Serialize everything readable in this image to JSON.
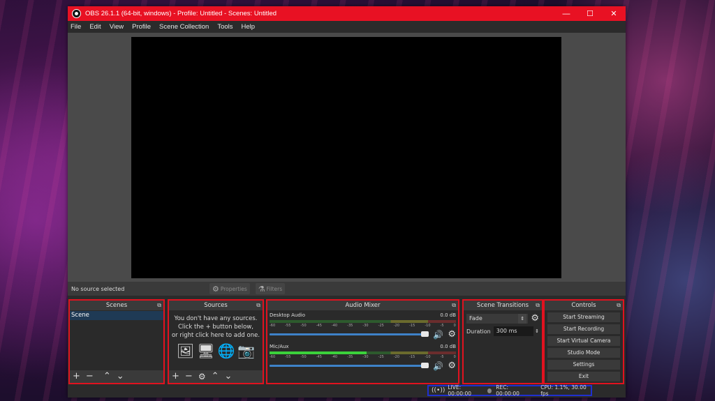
{
  "window": {
    "title": "OBS 26.1.1 (64-bit, windows) - Profile: Untitled - Scenes: Untitled"
  },
  "menu": [
    "File",
    "Edit",
    "View",
    "Profile",
    "Scene Collection",
    "Tools",
    "Help"
  ],
  "source_bar": {
    "no_source": "No source selected",
    "properties": "Properties",
    "filters": "Filters"
  },
  "scenes": {
    "title": "Scenes",
    "items": [
      "Scene"
    ]
  },
  "sources": {
    "title": "Sources",
    "empty_line1": "You don't have any sources.",
    "empty_line2": "Click the + button below,",
    "empty_line3": "or right click here to add one."
  },
  "mixer": {
    "title": "Audio Mixer",
    "tracks": [
      {
        "name": "Desktop Audio",
        "db": "0.0 dB",
        "level": 0.0
      },
      {
        "name": "Mic/Aux",
        "db": "0.0 dB",
        "level": 0.52
      }
    ],
    "ticks": [
      "-60",
      "-55",
      "-50",
      "-45",
      "-40",
      "-35",
      "-30",
      "-25",
      "-20",
      "-15",
      "-10",
      "-5",
      "0"
    ]
  },
  "transitions": {
    "title": "Scene Transitions",
    "selected": "Fade",
    "duration_label": "Duration",
    "duration_value": "300 ms"
  },
  "controls": {
    "title": "Controls",
    "buttons": [
      "Start Streaming",
      "Start Recording",
      "Start Virtual Camera",
      "Studio Mode",
      "Settings",
      "Exit"
    ]
  },
  "status": {
    "live": "LIVE: 00:00:00",
    "rec": "REC: 00:00:00",
    "cpu": "CPU: 1.1%, 30.00 fps"
  },
  "colors": {
    "title_bar": "#e81123",
    "panel_outline": "#e1121f",
    "status_outline": "#2030d0",
    "slider": "#3e82c8"
  }
}
